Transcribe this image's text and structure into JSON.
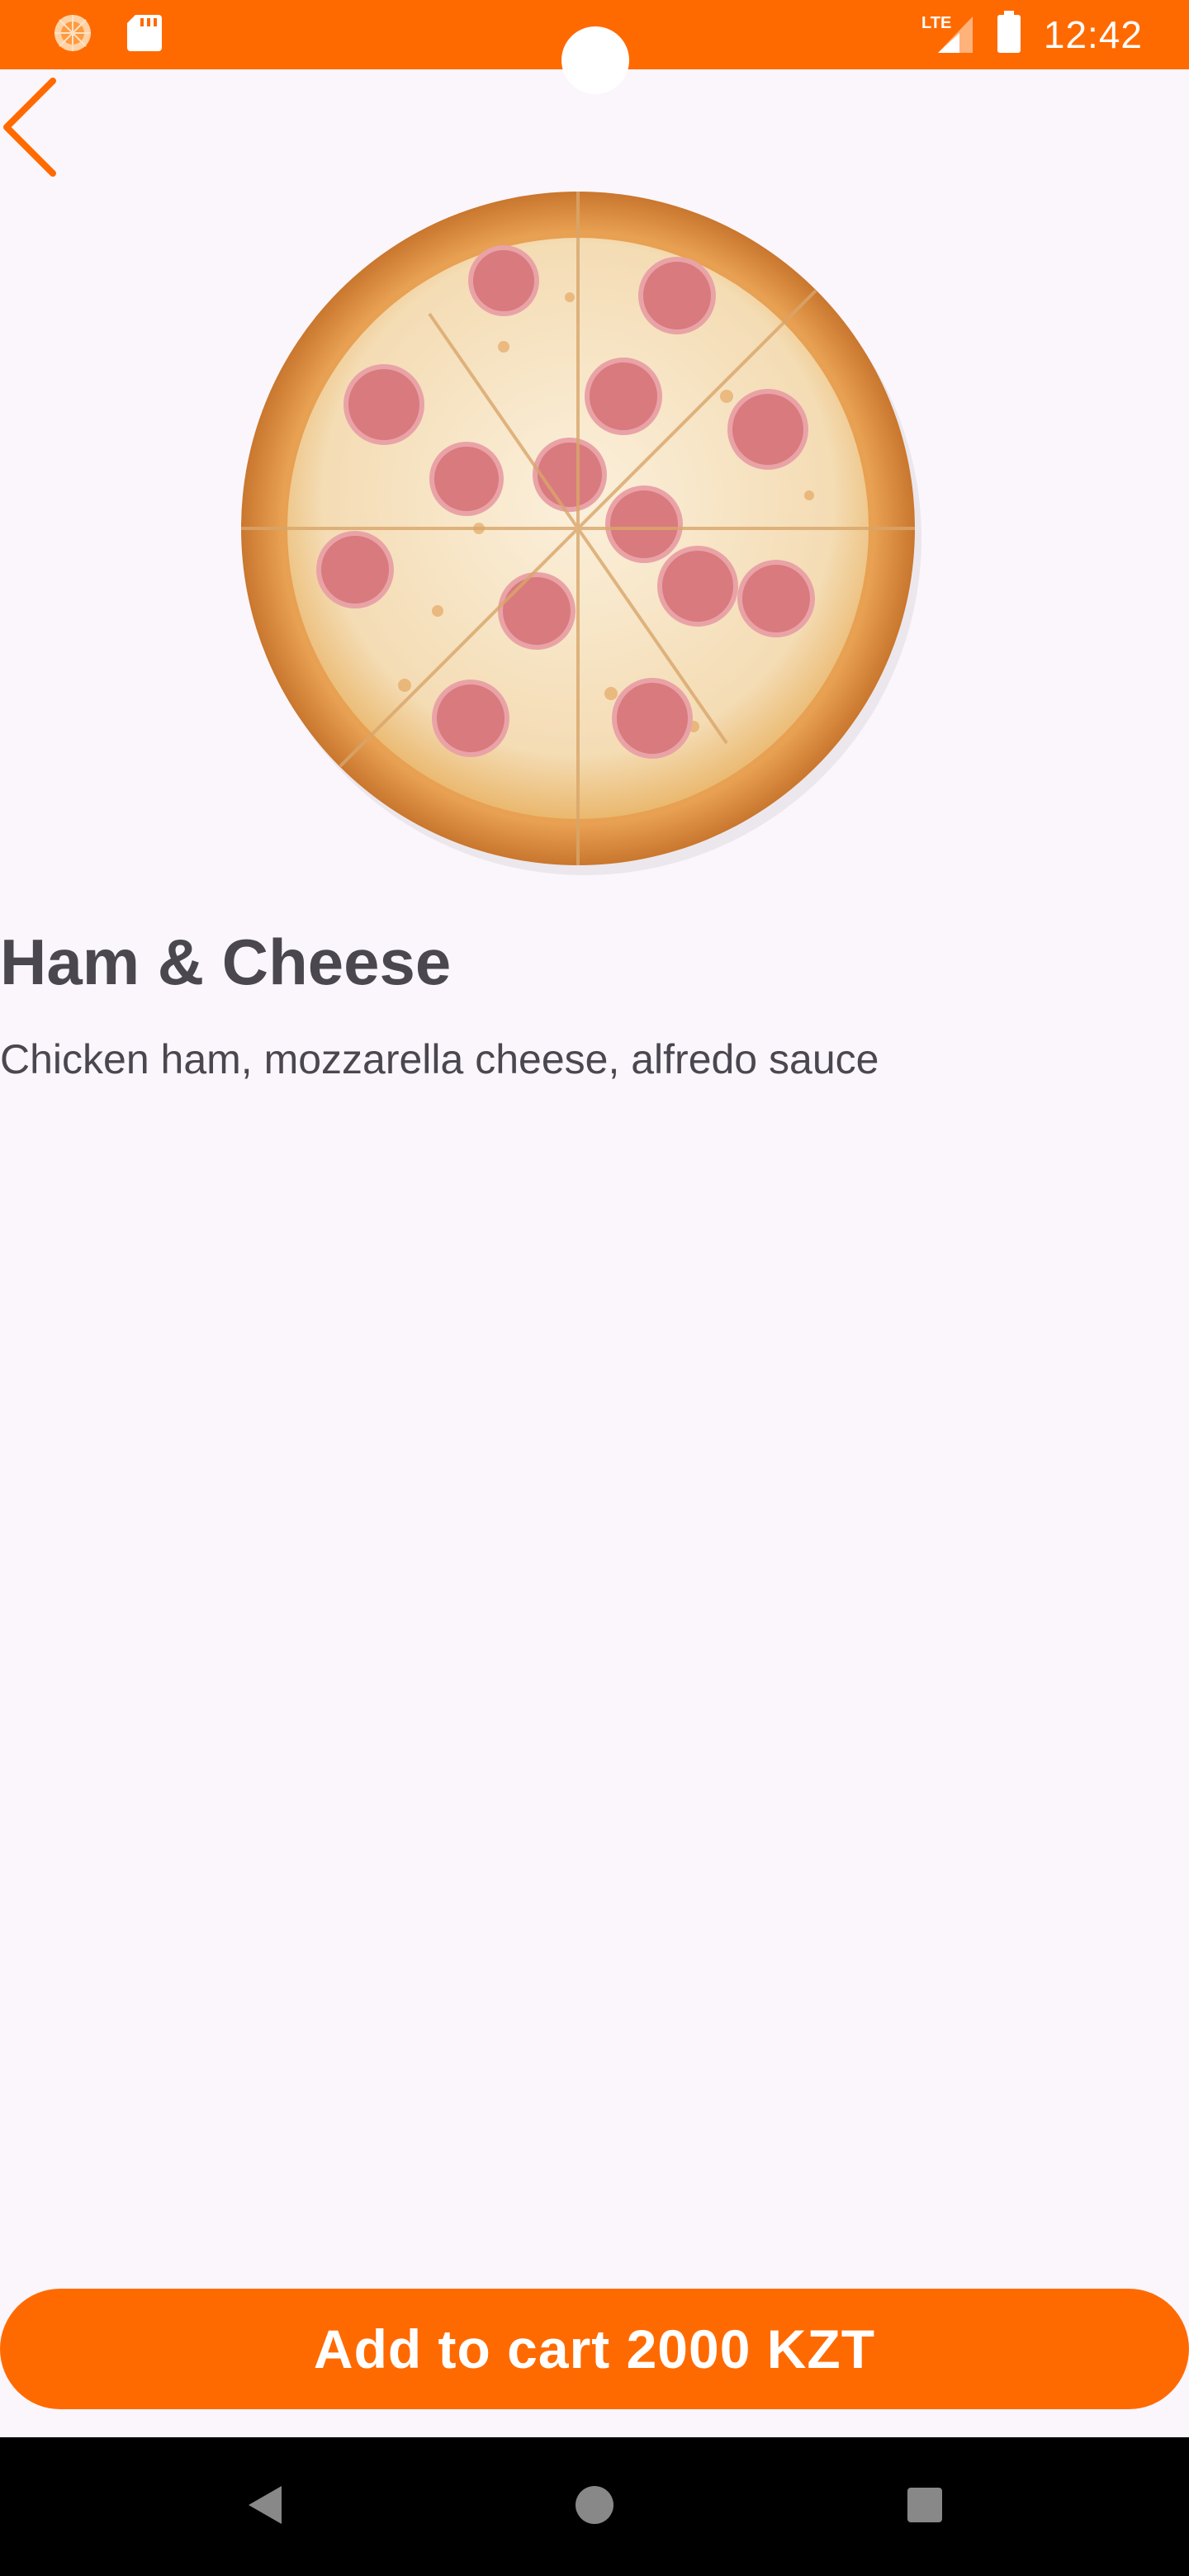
{
  "status_bar": {
    "time": "12:42",
    "network": "LTE",
    "icons": [
      "app-notification-icon",
      "sd-card-icon",
      "lte-signal-icon",
      "battery-icon"
    ]
  },
  "colors": {
    "accent": "#ff6a00",
    "background": "#fbf6fc",
    "text": "#4a474f",
    "nav_bar": "#000000"
  },
  "product": {
    "image_icon": "pizza-image",
    "title": "Ham & Cheese",
    "description": "Chicken ham, mozzarella cheese, alfredo sauce"
  },
  "actions": {
    "back_icon": "chevron-left-icon",
    "add_to_cart_label": "Add to cart 2000 KZT"
  },
  "nav": {
    "icons": [
      "back-triangle-icon",
      "home-circle-icon",
      "recents-square-icon"
    ]
  }
}
